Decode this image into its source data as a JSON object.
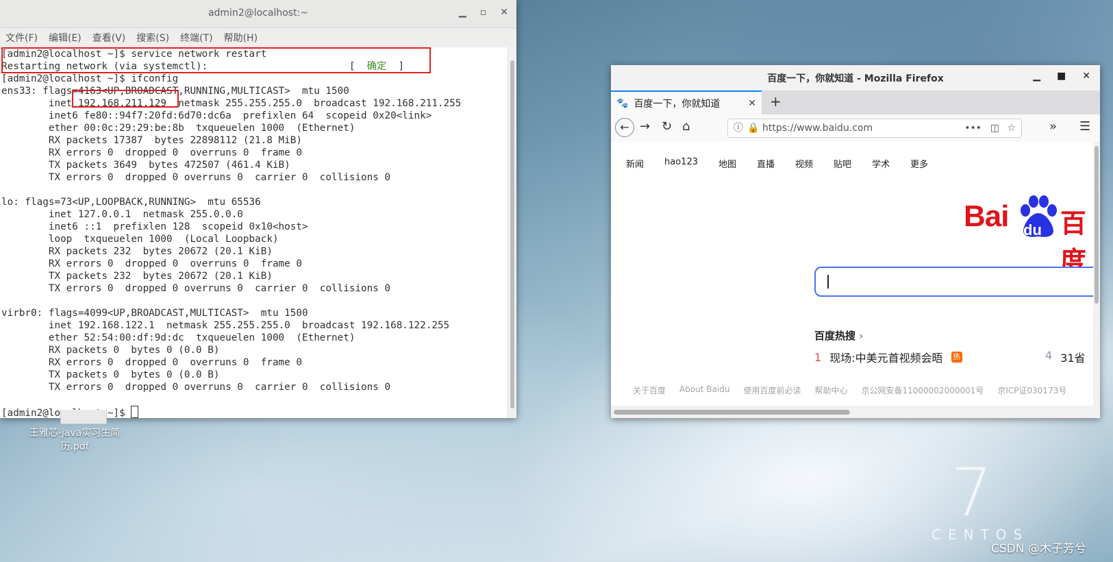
{
  "terminal": {
    "title": "admin2@localhost:~",
    "menu": [
      "文件(F)",
      "编辑(E)",
      "查看(V)",
      "搜索(S)",
      "终端(T)",
      "帮助(H)"
    ],
    "lines": {
      "l1": "[admin2@localhost ~]$ service network restart",
      "l2_pre": "Restarting network (via systemctl):                        [  ",
      "l2_ok": "确定",
      "l2_post": "  ]",
      "l3": "[admin2@localhost ~]$ ifconfig",
      "l4": "ens33: flags=4163<UP,BROADCAST,RUNNING,MULTICAST>  mtu 1500",
      "l5": "        inet 192.168.211.129  netmask 255.255.255.0  broadcast 192.168.211.255",
      "l6": "        inet6 fe80::94f7:20fd:6d70:dc6a  prefixlen 64  scopeid 0x20<link>",
      "l7": "        ether 00:0c:29:29:be:8b  txqueuelen 1000  (Ethernet)",
      "l8": "        RX packets 17387  bytes 22898112 (21.8 MiB)",
      "l9": "        RX errors 0  dropped 0  overruns 0  frame 0",
      "l10": "        TX packets 3649  bytes 472507 (461.4 KiB)",
      "l11": "        TX errors 0  dropped 0 overruns 0  carrier 0  collisions 0",
      "l12": "",
      "l13": "lo: flags=73<UP,LOOPBACK,RUNNING>  mtu 65536",
      "l14": "        inet 127.0.0.1  netmask 255.0.0.0",
      "l15": "        inet6 ::1  prefixlen 128  scopeid 0x10<host>",
      "l16": "        loop  txqueuelen 1000  (Local Loopback)",
      "l17": "        RX packets 232  bytes 20672 (20.1 KiB)",
      "l18": "        RX errors 0  dropped 0  overruns 0  frame 0",
      "l19": "        TX packets 232  bytes 20672 (20.1 KiB)",
      "l20": "        TX errors 0  dropped 0 overruns 0  carrier 0  collisions 0",
      "l21": "",
      "l22": "virbr0: flags=4099<UP,BROADCAST,MULTICAST>  mtu 1500",
      "l23": "        inet 192.168.122.1  netmask 255.255.255.0  broadcast 192.168.122.255",
      "l24": "        ether 52:54:00:df:9d:dc  txqueuelen 1000  (Ethernet)",
      "l25": "        RX packets 0  bytes 0 (0.0 B)",
      "l26": "        RX errors 0  dropped 0  overruns 0  frame 0",
      "l27": "        TX packets 0  bytes 0 (0.0 B)",
      "l28": "        TX errors 0  dropped 0 overruns 0  carrier 0  collisions 0",
      "l29": "",
      "l30": "[admin2@localhost ~]$ "
    }
  },
  "desktop": {
    "file_label": "王雅芯-java实习生简历.pdf"
  },
  "firefox": {
    "title": "百度一下，你就知道 - Mozilla Firefox",
    "tab_title": "百度一下，你就知道",
    "url": "https://www.baidu.com",
    "baidu": {
      "nav": [
        "新闻",
        "hao123",
        "地图",
        "直播",
        "视频",
        "贴吧",
        "学术",
        "更多"
      ],
      "logo_bai": "Bai",
      "logo_du": "du",
      "logo_cn": "百度",
      "hot_title": "百度热搜",
      "hot_items": [
        {
          "rank": "1",
          "text": "现场:中美元首视频会晤",
          "badge": "热"
        },
        {
          "rank": "4",
          "text": "31省"
        }
      ],
      "footer": [
        "关于百度",
        "About Baidu",
        "使用百度前必读",
        "帮助中心",
        "京公网安备11000002000001号",
        "京ICP证030173号"
      ]
    }
  },
  "watermark": {
    "centos_number": "7",
    "centos_word": "CENTOS",
    "csdn": "CSDN @木子芳兮"
  },
  "colors": {
    "highlight_red": "#e02020",
    "ok_green": "#3a8a1f",
    "baidu_red": "#e1131b",
    "baidu_blue": "#2932e1",
    "search_border": "#4e6ef2"
  }
}
